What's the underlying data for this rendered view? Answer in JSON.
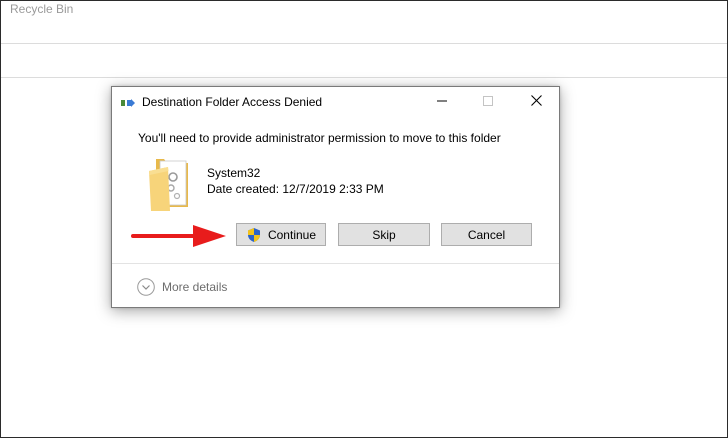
{
  "explorer": {
    "title": "Recycle Bin"
  },
  "dialog": {
    "title": "Destination Folder Access Denied",
    "message": "You'll need to provide administrator permission to move to this folder",
    "file": {
      "name": "System32",
      "date_created": "Date created: 12/7/2019 2:33 PM"
    },
    "buttons": {
      "continue": "Continue",
      "skip": "Skip",
      "cancel": "Cancel"
    },
    "more_details": "More details",
    "icons": {
      "app": "file-move-icon",
      "folder": "folder-icon",
      "shield": "uac-shield-icon",
      "minimize": "minimize-icon",
      "maximize": "maximize-icon",
      "close": "close-icon",
      "expand": "chevron-down-circle-icon"
    }
  },
  "annotation": {
    "arrow_color": "#e81c1c",
    "icon": "red-arrow-icon"
  },
  "colors": {
    "button_bg": "#e1e1e1",
    "button_border": "#adadad",
    "folder_yellow": "#f7d47a",
    "muted_text": "#6d6d6d"
  }
}
